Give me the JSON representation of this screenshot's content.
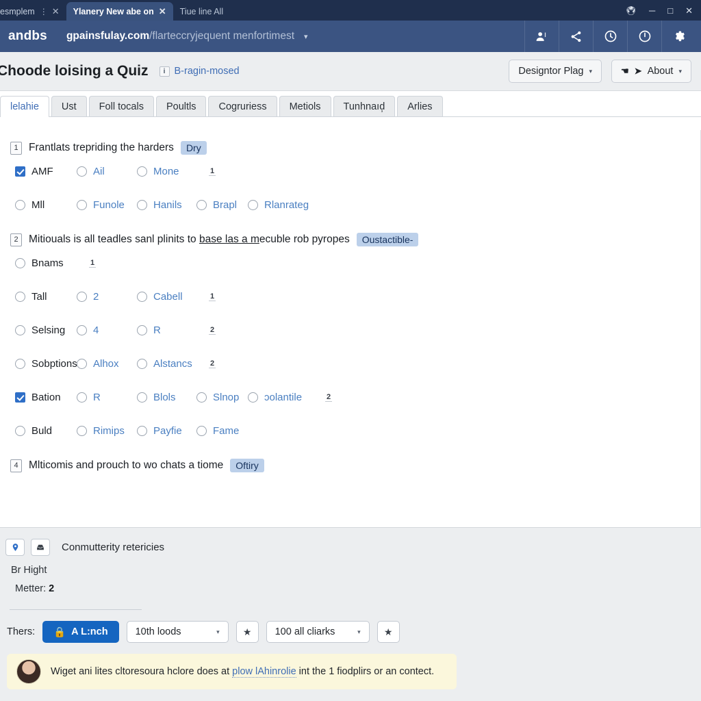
{
  "browser": {
    "tabs": [
      {
        "label": "esmplem",
        "active": false,
        "has_menu": true,
        "has_close": true
      },
      {
        "label": "Ylanery New abe on",
        "active": true,
        "has_menu": false,
        "has_close": true
      },
      {
        "label": "Tiue line All",
        "active": false,
        "has_menu": false,
        "has_close": false
      }
    ],
    "window_controls": [
      "restore-down",
      "minimize",
      "maximize",
      "close"
    ],
    "brand": "andbs",
    "url_host": "gpainsfulay.com",
    "url_path": "/flarteccryjequent menfortimest",
    "url_caret": "▾",
    "toolbar_icons": [
      "person-add-icon",
      "share-icon",
      "clock-icon",
      "info-circle-icon",
      "gear-icon"
    ]
  },
  "header": {
    "title": "Choode loising a Quiz",
    "badge_icon_label": "i",
    "badge_label": "B-ragin-mosed",
    "buttons": [
      {
        "label": "Designtor Plag",
        "caret": "▾"
      },
      {
        "label": "About",
        "caret": "▾"
      }
    ]
  },
  "section_tabs": [
    {
      "label": "lelahie",
      "active": true
    },
    {
      "label": "Ust",
      "active": false
    },
    {
      "label": "Foll tocals",
      "active": false
    },
    {
      "label": "Poultls",
      "active": false
    },
    {
      "label": "Cogruriess",
      "active": false
    },
    {
      "label": "Metiols",
      "active": false
    },
    {
      "label": "Tunhnaıd̦",
      "active": false
    },
    {
      "label": "Arlies",
      "active": false
    }
  ],
  "questions": [
    {
      "number": "1",
      "text": "Frantlats trepriding the harders",
      "underline": "",
      "tag": "Dry",
      "rows": [
        {
          "options": [
            {
              "label": "AMF",
              "type": "checkbox",
              "checked": true,
              "dark": true
            },
            {
              "label": "Ail",
              "type": "radio",
              "checked": false,
              "dark": false
            },
            {
              "label": "Mone",
              "type": "radio",
              "checked": false,
              "dark": false
            }
          ],
          "count": "1"
        },
        {
          "options": [
            {
              "label": "Mll",
              "type": "radio",
              "checked": false,
              "dark": true
            },
            {
              "label": "Funole",
              "type": "radio",
              "checked": false,
              "dark": false
            },
            {
              "label": "Hanils",
              "type": "radio",
              "checked": false,
              "dark": false
            },
            {
              "label": "Brapl",
              "type": "radio",
              "checked": false,
              "dark": false
            },
            {
              "label": "Rlanrateg",
              "type": "radio",
              "checked": false,
              "dark": false
            }
          ],
          "count": ""
        }
      ]
    },
    {
      "number": "2",
      "text_before": "Mitiouals is all teadles sanl plinits to ",
      "text_underline": "base las a m",
      "text_after": "ecuble rob pyropes",
      "tag": "Oustactible-",
      "rows": [
        {
          "options": [
            {
              "label": "Bnams",
              "type": "radio",
              "checked": false,
              "dark": true
            }
          ],
          "count": "1"
        },
        {
          "options": [
            {
              "label": "Tall",
              "type": "radio",
              "checked": false,
              "dark": true
            },
            {
              "label": "2",
              "type": "radio",
              "checked": false,
              "dark": false
            },
            {
              "label": "Cabell",
              "type": "radio",
              "checked": false,
              "dark": false
            }
          ],
          "count": "1"
        },
        {
          "options": [
            {
              "label": "Selsing",
              "type": "radio",
              "checked": false,
              "dark": true
            },
            {
              "label": "4",
              "type": "radio",
              "checked": false,
              "dark": false
            },
            {
              "label": "R",
              "type": "radio",
              "checked": false,
              "dark": false
            }
          ],
          "count": "2"
        },
        {
          "options": [
            {
              "label": "Sobptions",
              "type": "radio",
              "checked": false,
              "dark": true
            },
            {
              "label": "Alhox",
              "type": "radio",
              "checked": false,
              "dark": false
            },
            {
              "label": "Alstancs",
              "type": "radio",
              "checked": false,
              "dark": false
            }
          ],
          "count": "2"
        },
        {
          "options": [
            {
              "label": "Bation",
              "type": "checkbox",
              "checked": true,
              "dark": true
            },
            {
              "label": "R",
              "type": "radio",
              "checked": false,
              "dark": false
            },
            {
              "label": "Blols",
              "type": "radio",
              "checked": false,
              "dark": false
            },
            {
              "label": "Slnop",
              "type": "radio",
              "checked": false,
              "dark": false
            },
            {
              "label": "ɔolantile",
              "type": "radio",
              "checked": false,
              "dark": false
            }
          ],
          "count": "2"
        },
        {
          "options": [
            {
              "label": "Buld",
              "type": "radio",
              "checked": false,
              "dark": true
            },
            {
              "label": "Rimips",
              "type": "radio",
              "checked": false,
              "dark": false
            },
            {
              "label": "Payfie",
              "type": "radio",
              "checked": false,
              "dark": false
            },
            {
              "label": "Fame",
              "type": "radio",
              "checked": false,
              "dark": false
            }
          ],
          "count": ""
        }
      ]
    },
    {
      "number": "4",
      "text": "Mlticomis and prouch to wo chats a tiome",
      "tag": "Oftiry",
      "rows": []
    }
  ],
  "bottom": {
    "icon_buttons": [
      "location-pin-icon",
      "inbox-icon"
    ],
    "label": "Conmutterity retericies",
    "hight_text": "Br Hight",
    "metter_label": "Metter:",
    "metter_value": "2",
    "row_label": "Thers:",
    "primary_button": {
      "label": "A L:nch",
      "icon": "lock-icon"
    },
    "selects": [
      {
        "label": "10th loods",
        "caret": "▾"
      },
      {
        "label": "100 all cliarks",
        "caret": "▾"
      }
    ],
    "star_icon": "★",
    "notice": {
      "avatar": "user-avatar",
      "text_before": "Wiget ani lites cltoresoura hclore does at ",
      "link": "plow lAhinrolie",
      "text_after": " int the 1 fiodplirs or an contect."
    }
  }
}
